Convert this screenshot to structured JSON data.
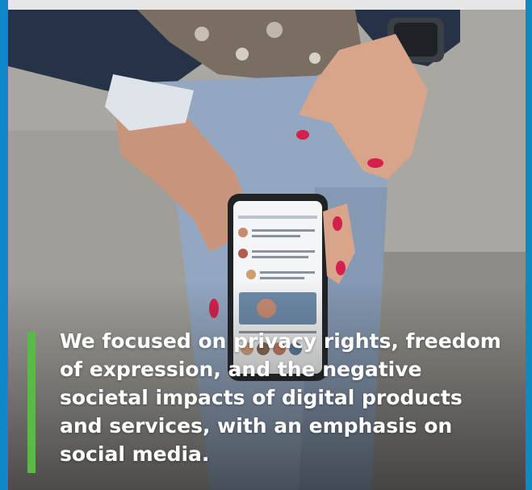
{
  "quote": {
    "text": "We focused on privacy rights, freedom of expression, and the negative societal impacts of digital products and services, with an emphasis on social media."
  },
  "colors": {
    "accent_bar": "#5bb947",
    "frame_rule": "#0e88c9",
    "text": "#ffffff"
  }
}
